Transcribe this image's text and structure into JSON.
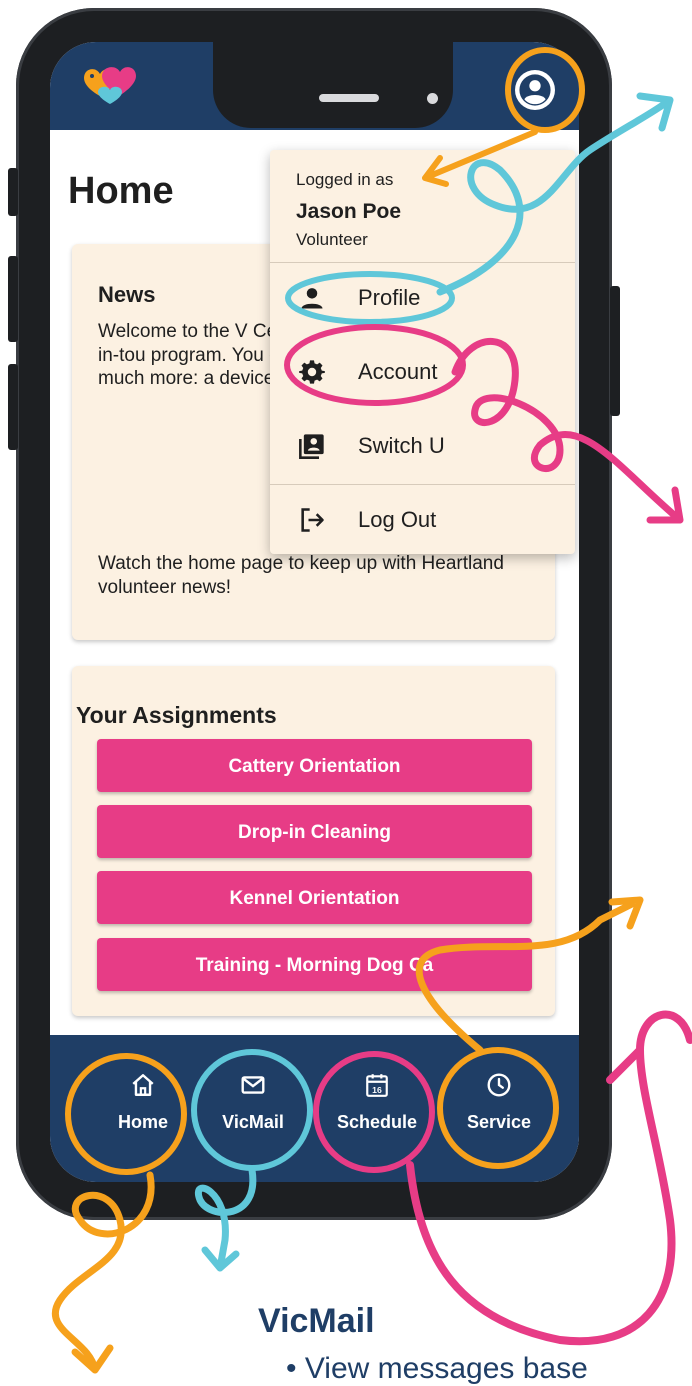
{
  "app": {
    "page_title": "Home"
  },
  "news": {
    "title": "News",
    "body": "Welcome to the V Center. This online way to keep-in-tou program. You can your volunteer ser and much more: a device.",
    "footer": "Watch the home page to keep up with Heartland volunteer news!"
  },
  "assignments": {
    "title": "Your Assignments",
    "items": [
      "Cattery Orientation",
      "Drop-in Cleaning",
      "Kennel Orientation",
      "Training - Morning Dog Ca"
    ]
  },
  "account_menu": {
    "logged_in_as": "Logged in as",
    "user_name": "Jason Poe",
    "role": "Volunteer",
    "items": [
      {
        "label": "Profile",
        "icon": "person-icon"
      },
      {
        "label": "Account",
        "icon": "gear-icon"
      },
      {
        "label": "Switch U",
        "icon": "contacts-icon"
      },
      {
        "label": "Log Out",
        "icon": "logout-icon"
      }
    ]
  },
  "bottom_nav": {
    "items": [
      {
        "label": "Home",
        "icon": "home-icon"
      },
      {
        "label": "VicMail",
        "icon": "mail-icon"
      },
      {
        "label": "Schedule",
        "icon": "calendar-icon"
      },
      {
        "label": "Service",
        "icon": "clock-icon"
      }
    ],
    "calendar_day": "16"
  },
  "caption": {
    "title": "VicMail",
    "bullet": "View messages base"
  },
  "colors": {
    "navy": "#1f3e66",
    "pink": "#e73c86",
    "cream": "#fcf1e2",
    "orange": "#f6a11c",
    "teal": "#5fc7d9"
  }
}
